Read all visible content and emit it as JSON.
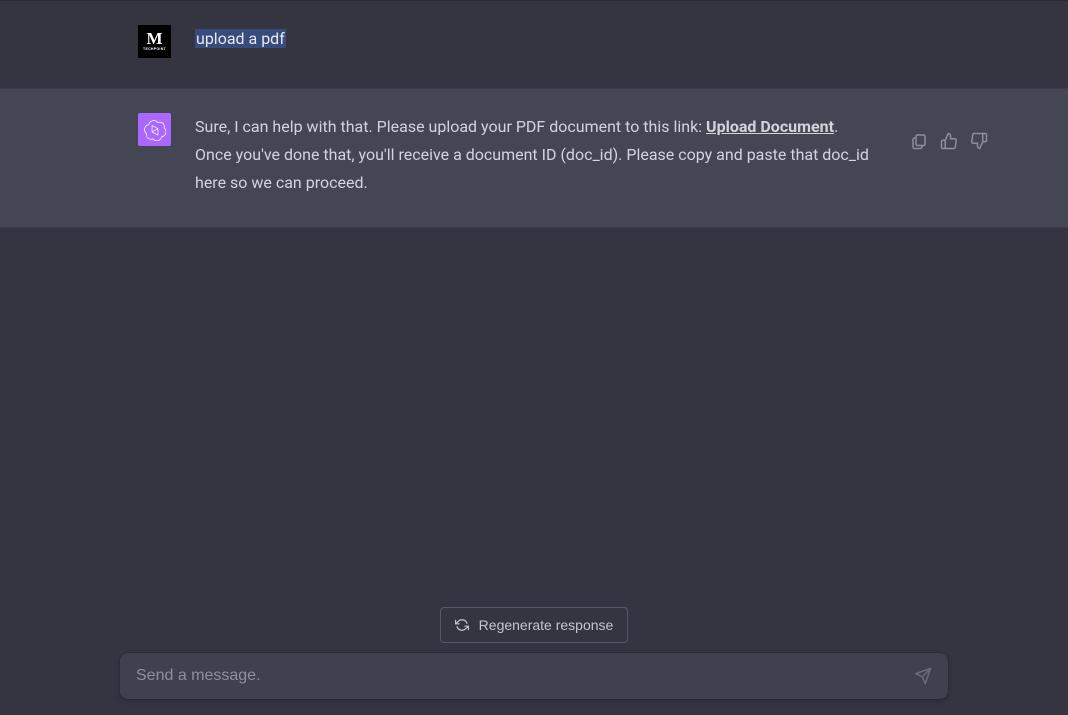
{
  "user_message": {
    "text": "upload a pdf",
    "avatar_main": "M",
    "avatar_sub": "TECHPOINT"
  },
  "assistant_message": {
    "text_before_link": "Sure, I can help with that. Please upload your PDF document to this link: ",
    "link_text": "Upload Document",
    "text_after_link": ". Once you've done that, you'll receive a document ID (doc_id). Please copy and paste that doc_id here so we can proceed."
  },
  "controls": {
    "regenerate_label": "Regenerate response",
    "input_placeholder": "Send a message."
  }
}
